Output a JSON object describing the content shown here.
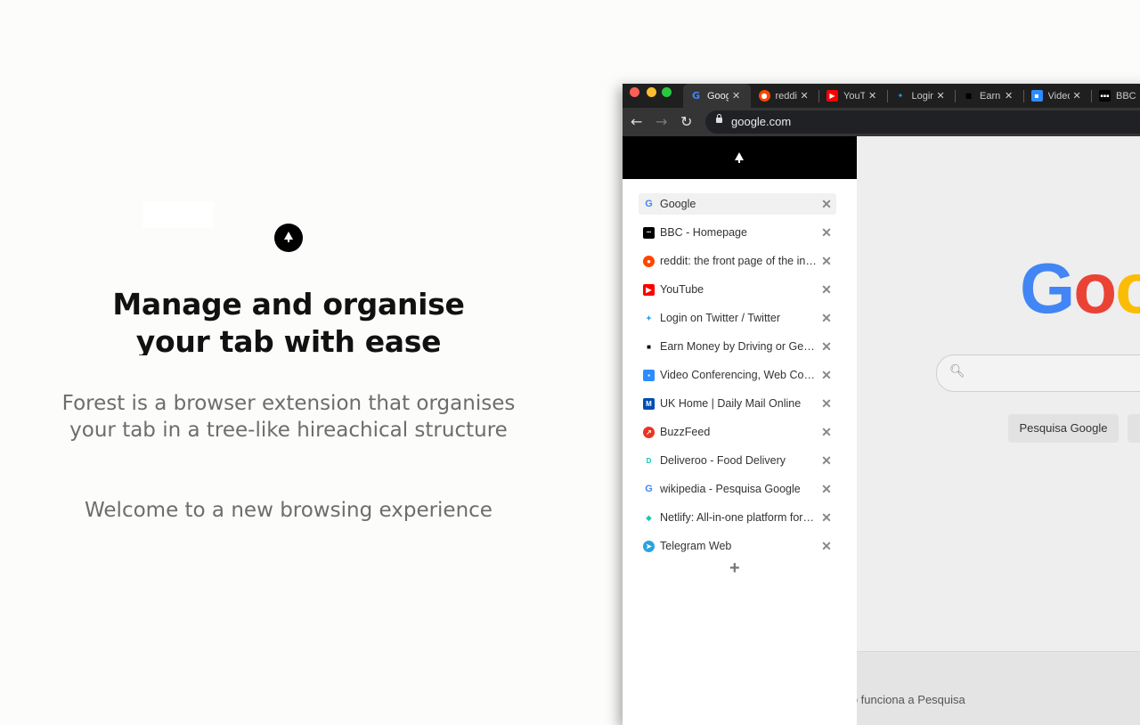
{
  "hero": {
    "title": "Manage and organise your tab with ease",
    "description": "Forest is a browser extension that organises your tab in a tree-like hireachical structure",
    "welcome": "Welcome to a new browsing experience",
    "logo_icon": "tree-icon"
  },
  "browser": {
    "tabs": [
      {
        "label": "Google",
        "icon": "google",
        "active": true
      },
      {
        "label": "reddit",
        "icon": "reddit"
      },
      {
        "label": "YouTube",
        "icon": "youtube"
      },
      {
        "label": "Login on Twitter",
        "icon": "twitter"
      },
      {
        "label": "Earn Money",
        "icon": "uber"
      },
      {
        "label": "Video Conferencing",
        "icon": "zoom"
      },
      {
        "label": "BBC",
        "icon": "bbc"
      }
    ],
    "url": "google.com",
    "page": {
      "logo": "Goo",
      "search_button": "Pesquisa Google",
      "footer_link": "mo funciona a Pesquisa"
    }
  },
  "forest": {
    "items": [
      {
        "label": "Google",
        "icon": "google",
        "active": true
      },
      {
        "label": "BBC - Homepage",
        "icon": "bbc"
      },
      {
        "label": "reddit: the front page of the internet",
        "icon": "reddit"
      },
      {
        "label": "YouTube",
        "icon": "youtube"
      },
      {
        "label": "Login on Twitter / Twitter",
        "icon": "twitter"
      },
      {
        "label": "Earn Money by Driving or Get a Ride Now | Uber",
        "icon": "uber"
      },
      {
        "label": "Video Conferencing, Web Conferencing | Zoom",
        "icon": "zoom"
      },
      {
        "label": "UK Home | Daily Mail Online",
        "icon": "dailymail"
      },
      {
        "label": "BuzzFeed",
        "icon": "buzzfeed"
      },
      {
        "label": "Deliveroo - Food Delivery",
        "icon": "deliveroo"
      },
      {
        "label": "wikipedia - Pesquisa Google",
        "icon": "google"
      },
      {
        "label": "Netlify: All-in-one platform for automating modern web projects",
        "icon": "netlify"
      },
      {
        "label": "Telegram Web",
        "icon": "telegram"
      }
    ],
    "close_glyph": "✕",
    "add_glyph": "+"
  },
  "colors": {
    "google_blue": "#4285f4",
    "google_red": "#ea4335",
    "google_yellow": "#fbbc05",
    "google_green": "#34a853"
  }
}
